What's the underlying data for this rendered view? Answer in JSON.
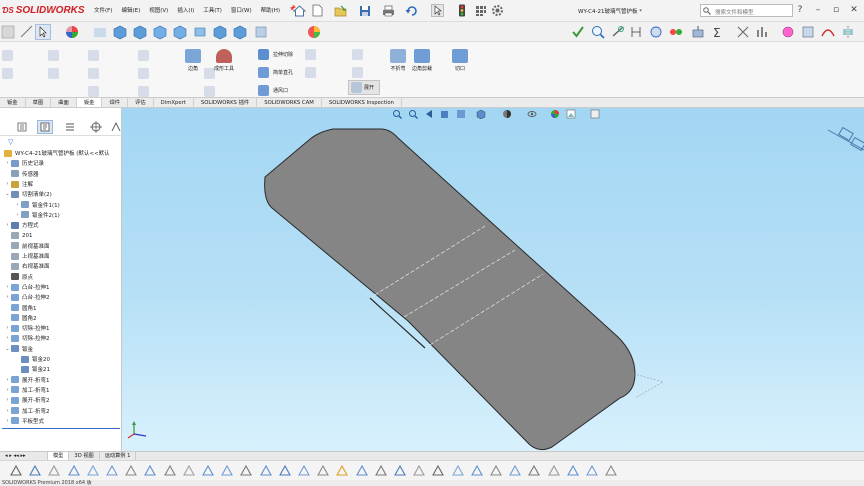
{
  "app": {
    "brand": "SOLIDWORKS",
    "document_title": "WY-C4-21玻璃气管护板 *",
    "search_placeholder": "搜索文件和模型"
  },
  "menu": [
    "文件(F)",
    "编辑(E)",
    "视图(V)",
    "插入(I)",
    "工具(T)",
    "窗口(W)",
    "帮助(H)"
  ],
  "ribbon": {
    "tools_col1": [
      "拉伸切除",
      "简单直孔",
      "通风口"
    ],
    "bigtools": [
      "边角",
      "成形工具",
      "展开"
    ],
    "bigtools_right": [
      "不折弯",
      "边角剪裁",
      "切口"
    ]
  },
  "tabs": [
    {
      "label": "钣金",
      "active": false
    },
    {
      "label": "草图",
      "active": false
    },
    {
      "label": "曲面",
      "active": false
    },
    {
      "label": "钣金",
      "active": true
    },
    {
      "label": "焊件",
      "active": false
    },
    {
      "label": "评估",
      "active": false
    },
    {
      "label": "DimXpert",
      "active": false
    },
    {
      "label": "SOLIDWORKS 插件",
      "active": false
    },
    {
      "label": "SOLIDWORKS CAM",
      "active": false
    },
    {
      "label": "SOLIDWORKS Inspection",
      "active": false
    }
  ],
  "tree": {
    "root": "WY-C4-21玻璃气管护板 (默认<<默认",
    "items": [
      {
        "label": "历史记录",
        "level": 1,
        "arrow": "›",
        "icon": "#7a9bc7"
      },
      {
        "label": "传感器",
        "level": 1,
        "arrow": "",
        "icon": "#8aa0b8"
      },
      {
        "label": "注解",
        "level": 1,
        "arrow": "›",
        "icon": "#c9a33b"
      },
      {
        "label": "切割清单(2)",
        "level": 1,
        "arrow": "⌄",
        "icon": "#6f8fb5"
      },
      {
        "label": "钣金件1(1)",
        "level": 2,
        "arrow": "›",
        "icon": "#7f9fc4"
      },
      {
        "label": "钣金件2(1)",
        "level": 2,
        "arrow": "›",
        "icon": "#7f9fc4"
      },
      {
        "label": "方程式",
        "level": 1,
        "arrow": "›",
        "icon": "#5d7fb0"
      },
      {
        "label": "201",
        "level": 1,
        "arrow": "",
        "icon": "#9aa7b5"
      },
      {
        "label": "前视基准面",
        "level": 1,
        "arrow": "",
        "icon": "#9aa7b5"
      },
      {
        "label": "上视基准面",
        "level": 1,
        "arrow": "",
        "icon": "#9aa7b5"
      },
      {
        "label": "右视基准面",
        "level": 1,
        "arrow": "",
        "icon": "#9aa7b5"
      },
      {
        "label": "原点",
        "level": 1,
        "arrow": "",
        "icon": "#555555"
      },
      {
        "label": "凸台-拉伸1",
        "level": 1,
        "arrow": "›",
        "icon": "#7ba4d6"
      },
      {
        "label": "凸台-拉伸2",
        "level": 1,
        "arrow": "›",
        "icon": "#7ba4d6"
      },
      {
        "label": "圆角1",
        "level": 1,
        "arrow": "",
        "icon": "#7ba4d6"
      },
      {
        "label": "圆角2",
        "level": 1,
        "arrow": "",
        "icon": "#7ba4d6"
      },
      {
        "label": "切除-拉伸1",
        "level": 1,
        "arrow": "›",
        "icon": "#7ba4d6"
      },
      {
        "label": "切除-拉伸2",
        "level": 1,
        "arrow": "›",
        "icon": "#7ba4d6"
      },
      {
        "label": "钣金",
        "level": 1,
        "arrow": "⌄",
        "icon": "#6d8fbf"
      },
      {
        "label": "钣金20",
        "level": 2,
        "arrow": "",
        "icon": "#6d8fbf"
      },
      {
        "label": "钣金21",
        "level": 2,
        "arrow": "",
        "icon": "#6d8fbf"
      },
      {
        "label": "展开-折弯1",
        "level": 1,
        "arrow": "›",
        "icon": "#7ba4d6"
      },
      {
        "label": "加工-折弯1",
        "level": 1,
        "arrow": "›",
        "icon": "#7ba4d6"
      },
      {
        "label": "展开-折弯2",
        "level": 1,
        "arrow": "›",
        "icon": "#7ba4d6"
      },
      {
        "label": "加工-折弯2",
        "level": 1,
        "arrow": "›",
        "icon": "#7ba4d6"
      },
      {
        "label": "平板型式",
        "level": 1,
        "arrow": "›",
        "icon": "#7ba4d6"
      }
    ]
  },
  "bottom_tabs": [
    {
      "label": "模型",
      "active": true
    },
    {
      "label": "3D 视图",
      "active": false
    },
    {
      "label": "运动算例 1",
      "active": false
    }
  ],
  "status": "SOLIDWORKS Premium 2018 x64 版",
  "colors": {
    "accent": "#d31f26",
    "viewport_top": "#a2d6f3",
    "viewport_bottom": "#d9f1fd",
    "part_fill": "#858585"
  }
}
